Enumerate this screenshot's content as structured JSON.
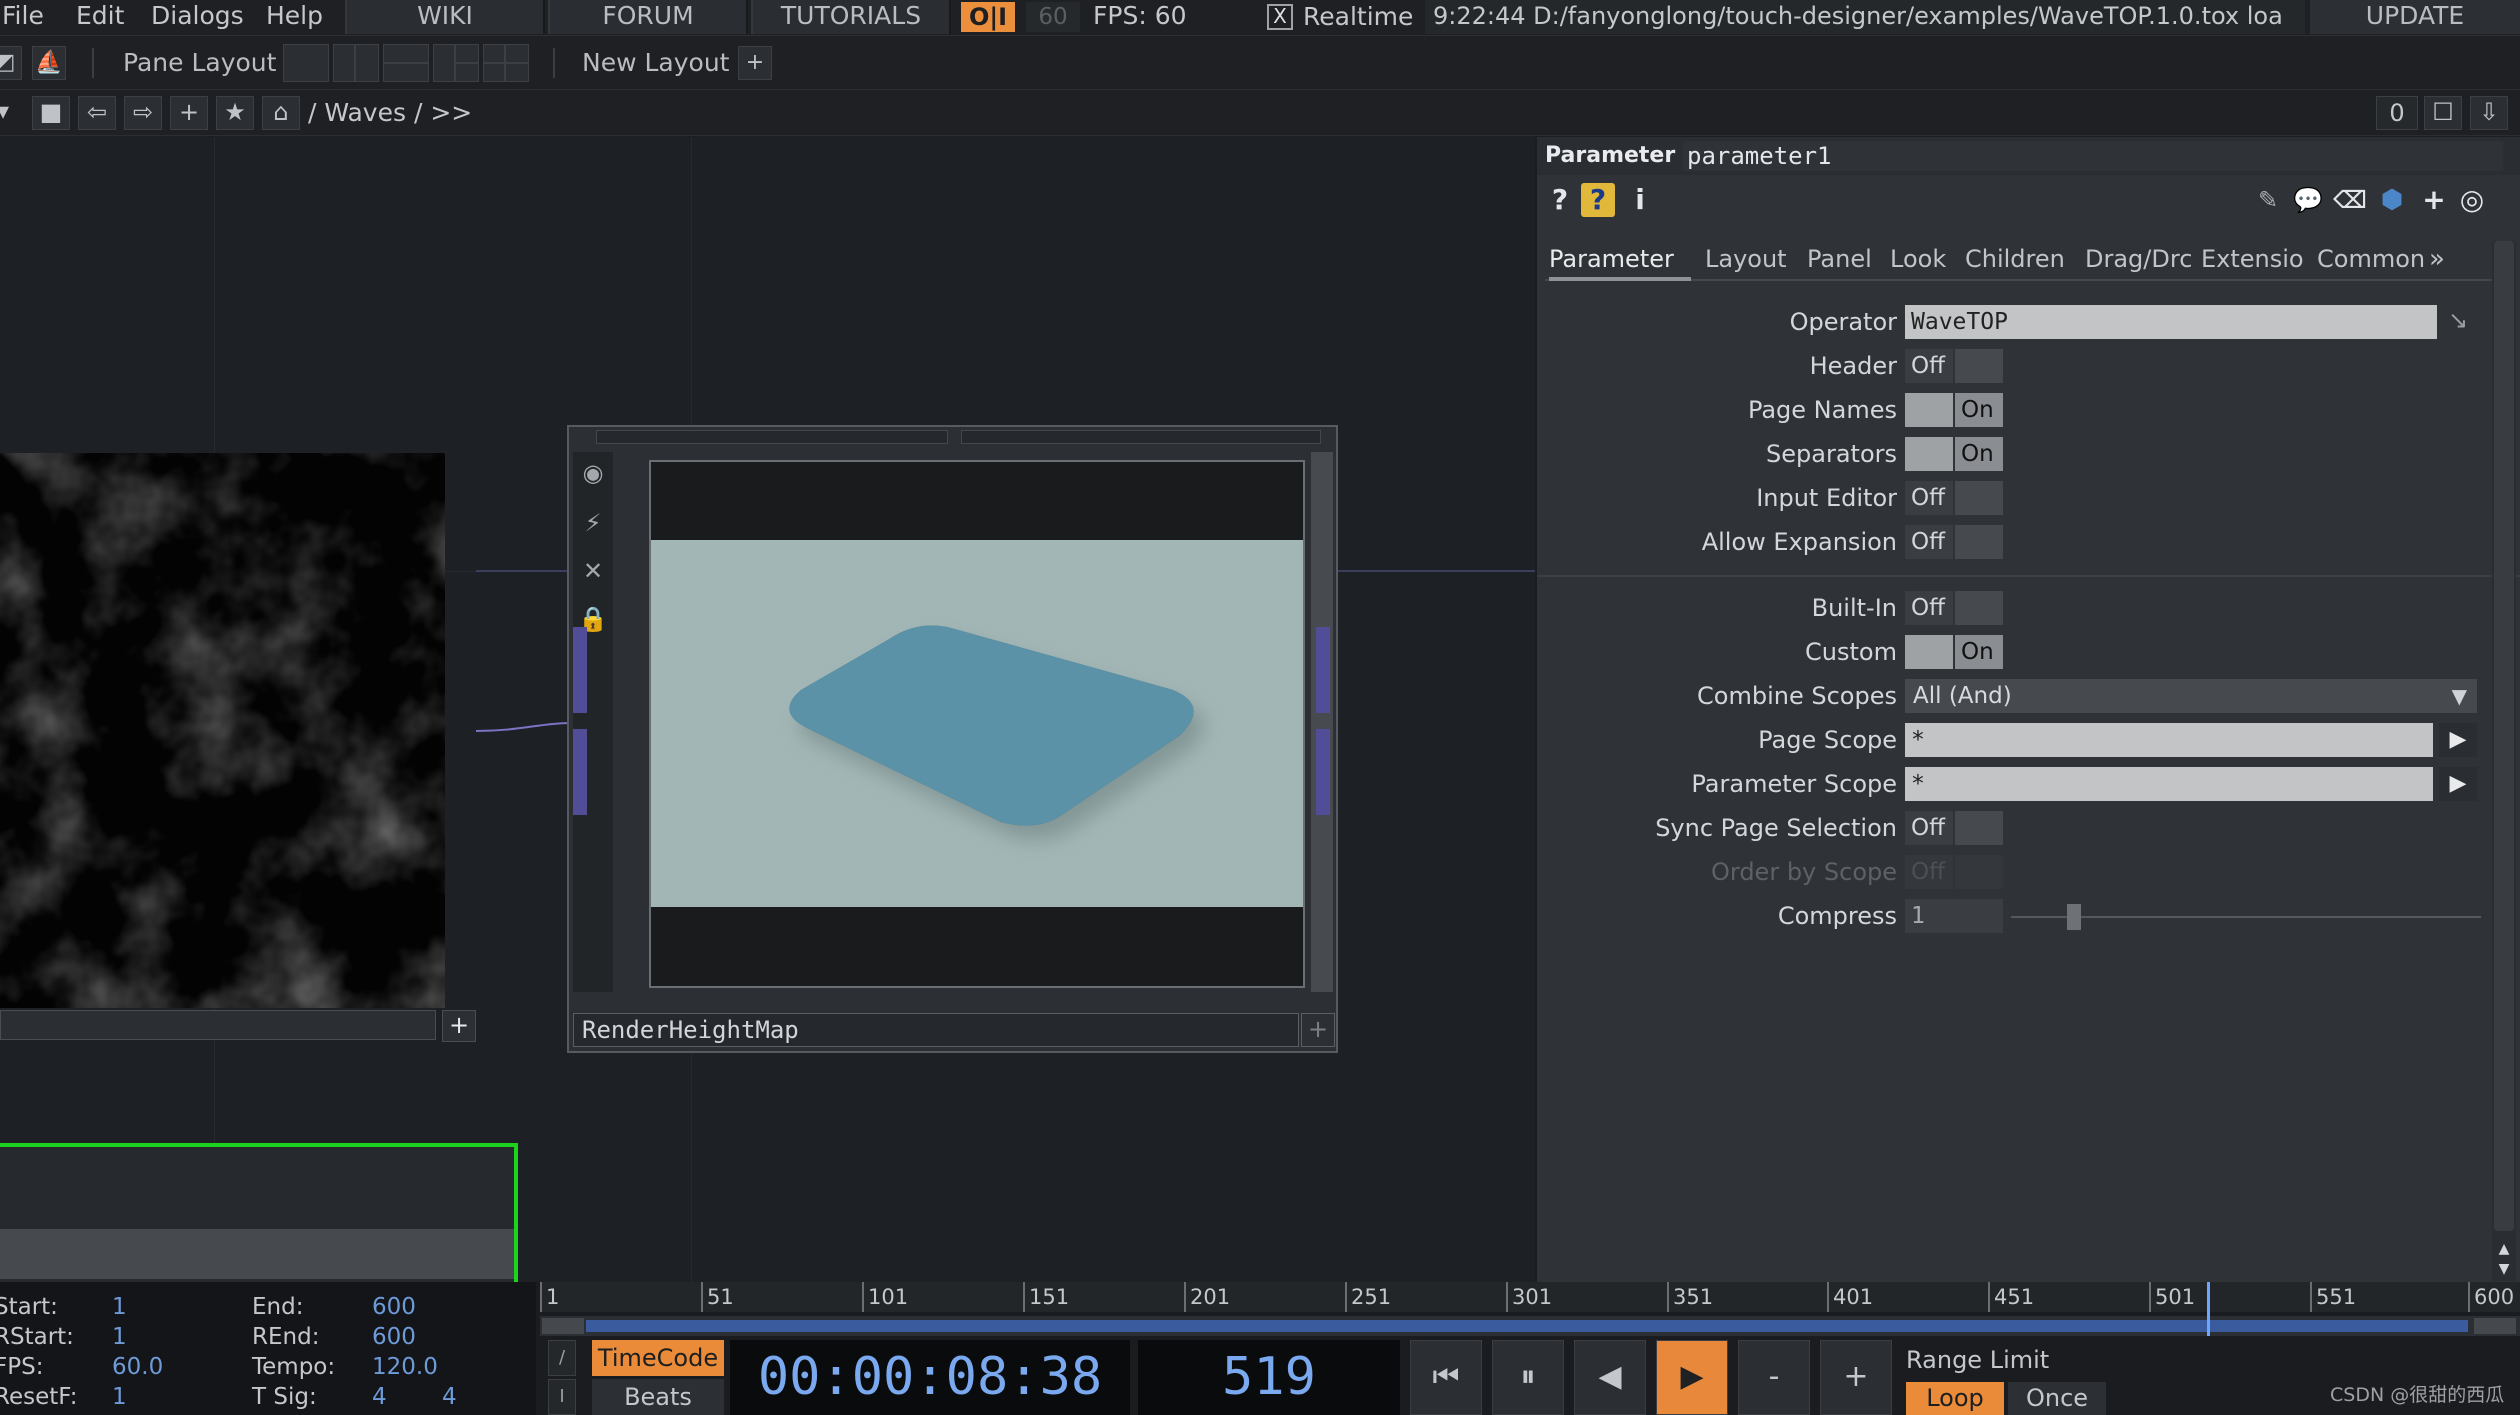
{
  "menu": {
    "items": [
      "File",
      "Edit",
      "Dialogs",
      "Help"
    ],
    "links": [
      "WIKI",
      "FORUM",
      "TUTORIALS"
    ],
    "oi_label": "O|I",
    "fps_cap": "60",
    "fps_label": "FPS:  60",
    "realtime_check": "X",
    "realtime_label": "Realtime",
    "status_message": "9:22:44 D:/fanyonglong/touch-designer/examples/WaveTOP.1.0.tox loa",
    "update_label": "UPDATE"
  },
  "panebar": {
    "pane_layout_label": "Pane Layout",
    "new_layout_label": "New Layout",
    "add_symbol": "+"
  },
  "pathbar": {
    "path": "/ Waves / >>",
    "pane_number": "0"
  },
  "network": {
    "node_name": "RenderHeightMap",
    "noise_plus": "+",
    "node_plus": "+"
  },
  "params": {
    "operator_type": "Parameter",
    "operator_name": "parameter1",
    "tabs": [
      "Parameter",
      "Layout",
      "Panel",
      "Look",
      "Children",
      "Drag/Drc",
      "Extensio",
      "Common"
    ],
    "tab_more": "»",
    "rows": {
      "operator": {
        "label": "Operator",
        "value": "WaveTOP"
      },
      "header": {
        "label": "Header",
        "value": "Off"
      },
      "page_names": {
        "label": "Page Names",
        "value": "On"
      },
      "separators": {
        "label": "Separators",
        "value": "On"
      },
      "input_editor": {
        "label": "Input Editor",
        "value": "Off"
      },
      "allow_expansion": {
        "label": "Allow Expansion",
        "value": "Off"
      },
      "built_in": {
        "label": "Built-In",
        "value": "Off"
      },
      "custom": {
        "label": "Custom",
        "value": "On"
      },
      "combine_scopes": {
        "label": "Combine Scopes",
        "value": "All (And)"
      },
      "page_scope": {
        "label": "Page Scope",
        "value": "*"
      },
      "parameter_scope": {
        "label": "Parameter Scope",
        "value": "*"
      },
      "sync_page_selection": {
        "label": "Sync Page Selection",
        "value": "Off"
      },
      "order_by_scope": {
        "label": "Order by Scope",
        "value": "Off"
      },
      "compress": {
        "label": "Compress",
        "value": "1",
        "slider_fraction": 0.12
      }
    }
  },
  "timeline": {
    "info": {
      "start_label": "Start:",
      "start": "1",
      "end_label": "End:",
      "end": "600",
      "rstart_label": "RStart:",
      "rstart": "1",
      "rend_label": "REnd:",
      "rend": "600",
      "fps_label": "FPS:",
      "fps": "60.0",
      "tempo_label": "Tempo:",
      "tempo": "120.0",
      "resetf_label": "ResetF:",
      "resetf": "1",
      "tsig_label": "T Sig:",
      "tsig_a": "4",
      "tsig_b": "4"
    },
    "ruler_ticks": [
      "1",
      "51",
      "101",
      "151",
      "201",
      "251",
      "301",
      "351",
      "401",
      "451",
      "501",
      "551",
      "600"
    ],
    "current_frame_value": 519,
    "frame_range": [
      1,
      600
    ],
    "timecode_label": "TimeCode",
    "beats_label": "Beats",
    "switch_top": "/",
    "switch_bottom": "I",
    "timecode": "00:00:08:38",
    "frame": "519",
    "transport": {
      "rewind": "⏮",
      "pause": "⏸",
      "step_back": "◀",
      "play": "▶",
      "minus": "-",
      "plus": "+"
    },
    "range_limit_label": "Range Limit",
    "loop_label": "Loop",
    "once_label": "Once"
  },
  "watermark": "CSDN @很甜的西瓜",
  "colors": {
    "accent_orange": "#ea8b3a",
    "timecode_blue": "#7aa9f0",
    "node_green": "#1dd31d",
    "connector_purple": "#514d97"
  }
}
